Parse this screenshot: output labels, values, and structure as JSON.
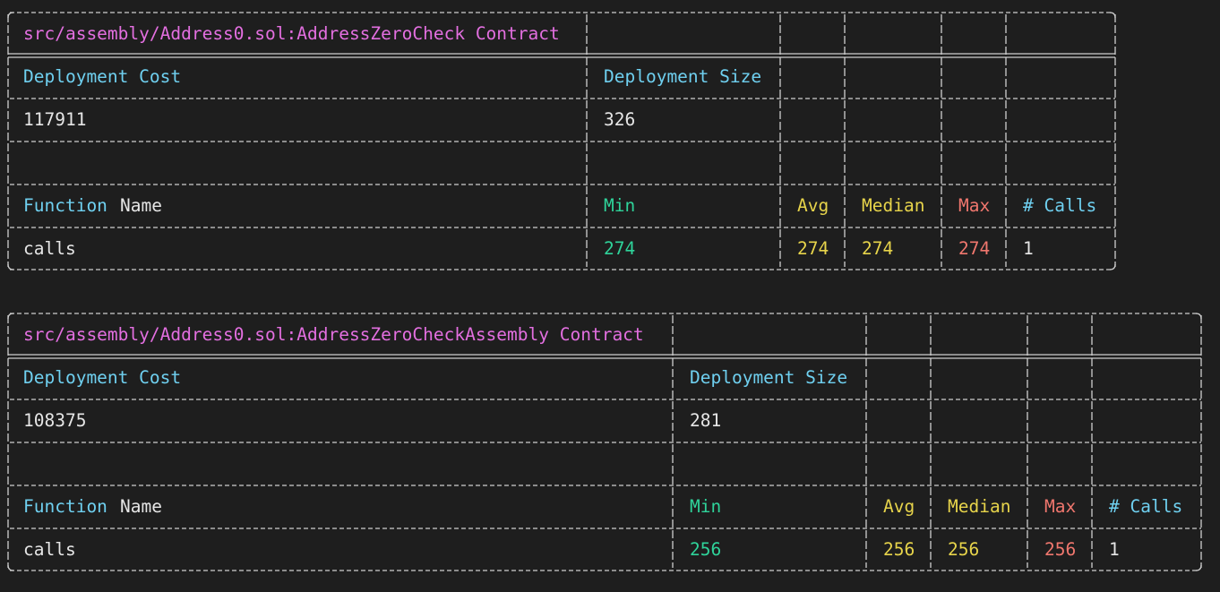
{
  "colors": {
    "background": "#1e1e1e",
    "border": "#cfcfcf",
    "contract_title": "#e36fe0",
    "header_label": "#6fd0f0",
    "default_text": "#e6e6e6",
    "min": "#2fd39a",
    "avg_median": "#e7d44b",
    "max": "#f0776e"
  },
  "tables": [
    {
      "contract_title": "src/assembly/Address0.sol:AddressZeroCheck Contract",
      "deployment_cost_label": "Deployment Cost",
      "deployment_size_label": "Deployment Size",
      "deployment_cost_value": "117911",
      "deployment_size_value": "326",
      "function_label": "Function",
      "name_label": "Name",
      "min_label": "Min",
      "avg_label": "Avg",
      "median_label": "Median",
      "max_label": "Max",
      "calls_label": "# Calls",
      "rows": [
        {
          "function": "calls",
          "min": "274",
          "avg": "274",
          "median": "274",
          "max": "274",
          "calls": "1"
        }
      ]
    },
    {
      "contract_title": "src/assembly/Address0.sol:AddressZeroCheckAssembly Contract",
      "deployment_cost_label": "Deployment Cost",
      "deployment_size_label": "Deployment Size",
      "deployment_cost_value": "108375",
      "deployment_size_value": "281",
      "function_label": "Function",
      "name_label": "Name",
      "min_label": "Min",
      "avg_label": "Avg",
      "median_label": "Median",
      "max_label": "Max",
      "calls_label": "# Calls",
      "rows": [
        {
          "function": "calls",
          "min": "256",
          "avg": "256",
          "median": "256",
          "max": "256",
          "calls": "1"
        }
      ]
    }
  ]
}
